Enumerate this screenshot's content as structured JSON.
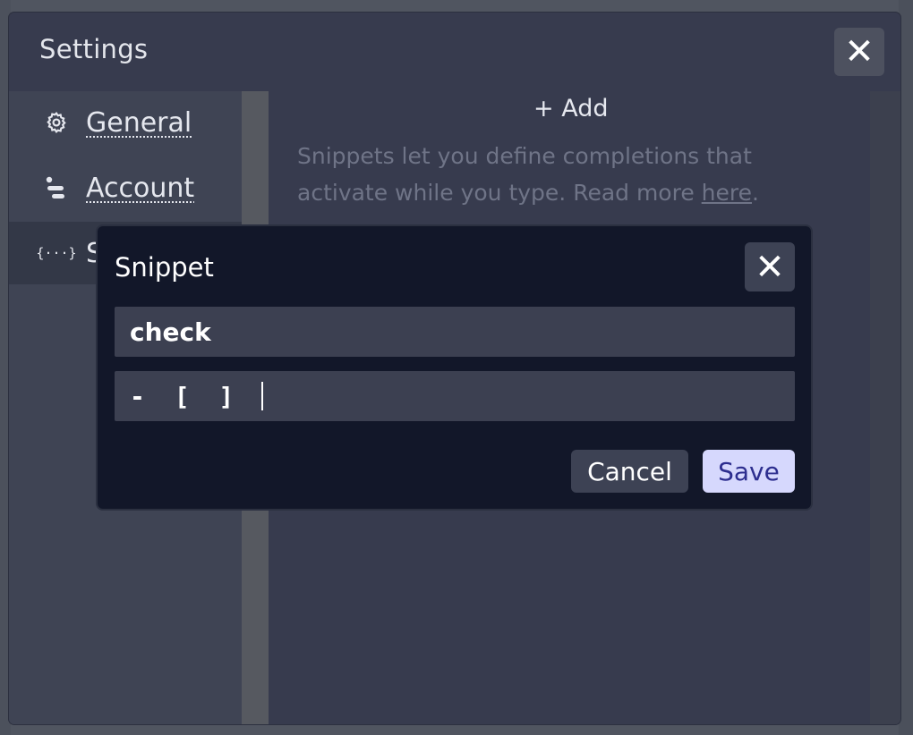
{
  "settings": {
    "title": "Settings",
    "close_icon": "close-icon",
    "nav": [
      {
        "label": "General",
        "icon": "gear-icon"
      },
      {
        "label": "Account",
        "icon": "account-icon"
      },
      {
        "label": "S",
        "icon": "snippets-icon"
      }
    ],
    "snippets_icon_glyph": "{···}",
    "add_label": "+ Add",
    "description_prefix": "Snippets let you define completions that activate while you type. Read more ",
    "description_link": "here",
    "description_suffix": "."
  },
  "dialog": {
    "title": "Snippet",
    "close_icon": "close-icon",
    "name_value": "check",
    "body_value": "- [ ] ",
    "cancel_label": "Cancel",
    "save_label": "Save"
  },
  "colors": {
    "save_bg": "#d6d8fd",
    "save_text": "#2d2e8f",
    "dialog_bg": "#121729",
    "settings_bg": "#373b4e"
  }
}
